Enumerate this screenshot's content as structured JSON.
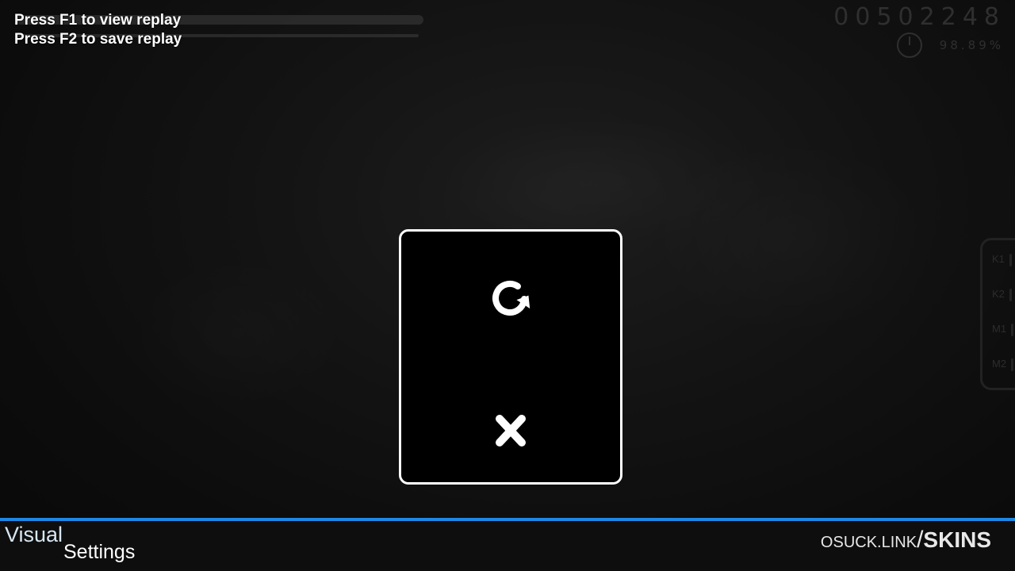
{
  "replay": {
    "line1": "Press F1 to view replay",
    "line2": "Press F2 to save replay"
  },
  "hud": {
    "score": "00502248",
    "accuracy": "98.89%"
  },
  "key_overlay": {
    "keys": [
      "K1",
      "K2",
      "M1",
      "M2"
    ]
  },
  "pause_menu": {
    "retry_icon": "retry-icon",
    "quit_icon": "close-icon"
  },
  "bottom_bar": {
    "visual_label": "Visual",
    "settings_label": "Settings",
    "brand_domain": "OSUCK.LINK",
    "brand_slash": "/",
    "brand_path": "SKINS"
  },
  "colors": {
    "accent_line": "#1e88e5",
    "menu_border": "#ffffff",
    "background": "#0b0b0b"
  }
}
